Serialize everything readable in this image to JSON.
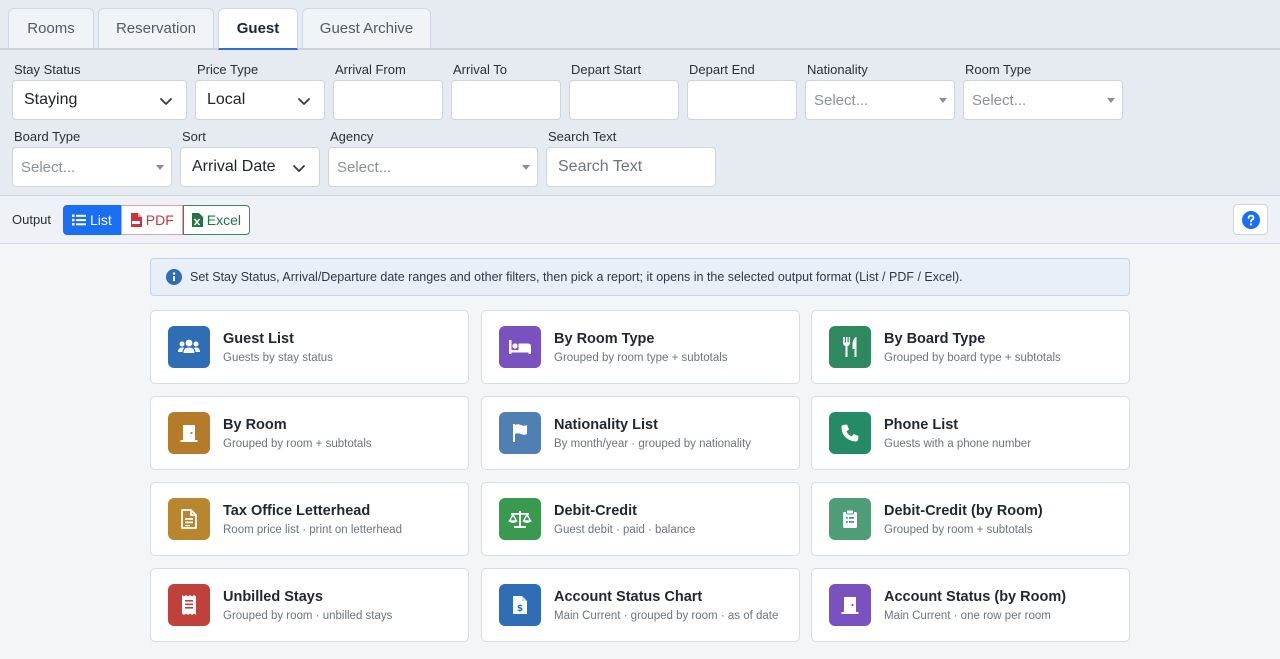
{
  "tabs": [
    {
      "label": "Rooms"
    },
    {
      "label": "Reservation"
    },
    {
      "label": "Guest"
    },
    {
      "label": "Guest Archive"
    }
  ],
  "filters": {
    "stay_status": {
      "label": "Stay Status",
      "value": "Staying"
    },
    "price_type": {
      "label": "Price Type",
      "value": "Local"
    },
    "arrival_from": {
      "label": "Arrival From",
      "value": ""
    },
    "arrival_to": {
      "label": "Arrival To",
      "value": ""
    },
    "depart_start": {
      "label": "Depart Start",
      "value": ""
    },
    "depart_end": {
      "label": "Depart End",
      "value": ""
    },
    "nationality": {
      "label": "Nationality",
      "placeholder": "Select..."
    },
    "room_type": {
      "label": "Room Type",
      "placeholder": "Select..."
    },
    "board_type": {
      "label": "Board Type",
      "placeholder": "Select..."
    },
    "sort": {
      "label": "Sort",
      "value": "Arrival Date"
    },
    "agency": {
      "label": "Agency",
      "placeholder": "Select..."
    },
    "search_text": {
      "label": "Search Text",
      "placeholder": "Search Text"
    }
  },
  "output": {
    "label": "Output",
    "list": "List",
    "pdf": "PDF",
    "excel": "Excel"
  },
  "info": "Set Stay Status, Arrival/Departure date ranges and other filters, then pick a report; it opens in the selected output format (List / PDF / Excel).",
  "reports": [
    {
      "title": "Guest List",
      "sub": "Guests by stay status",
      "icon": "users-icon",
      "color": "#2f6db5"
    },
    {
      "title": "By Room Type",
      "sub": "Grouped by room type + subtotals",
      "icon": "bed-icon",
      "color": "#7a52c0"
    },
    {
      "title": "By Board Type",
      "sub": "Grouped by board type + subtotals",
      "icon": "utensils-icon",
      "color": "#2e8a5e"
    },
    {
      "title": "By Room",
      "sub": "Grouped by room + subtotals",
      "icon": "door-icon",
      "color": "#b57a2a"
    },
    {
      "title": "Nationality List",
      "sub": "By month/year · grouped by nationality",
      "icon": "flag-icon",
      "color": "#4f7fb3"
    },
    {
      "title": "Phone List",
      "sub": "Guests with a phone number",
      "icon": "phone-icon",
      "color": "#258a66"
    },
    {
      "title": "Tax Office Letterhead",
      "sub": "Room price list · print on letterhead",
      "icon": "file-lines-icon",
      "color": "#b8862e"
    },
    {
      "title": "Debit-Credit",
      "sub": "Guest debit · paid · balance",
      "icon": "scale-icon",
      "color": "#38994f"
    },
    {
      "title": "Debit-Credit (by Room)",
      "sub": "Grouped by room + subtotals",
      "icon": "clipboard-icon",
      "color": "#4f9c78"
    },
    {
      "title": "Unbilled Stays",
      "sub": "Grouped by room · unbilled stays",
      "icon": "receipt-icon",
      "color": "#c0403c"
    },
    {
      "title": "Account Status Chart",
      "sub": "Main Current · grouped by room · as of date",
      "icon": "file-dollar-icon",
      "color": "#2f6db5"
    },
    {
      "title": "Account Status (by Room)",
      "sub": "Main Current · one row per room",
      "icon": "door-open-icon",
      "color": "#7a52c0"
    }
  ]
}
